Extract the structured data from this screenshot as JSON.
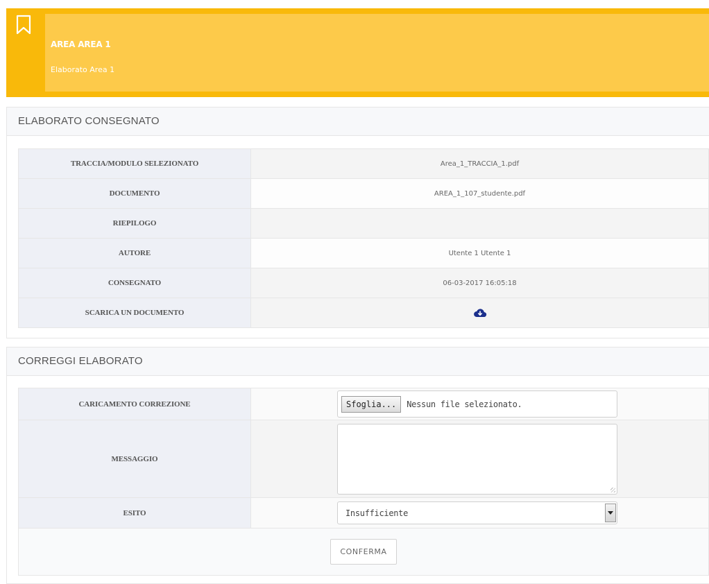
{
  "header": {
    "title": "AREA AREA 1",
    "subtitle": "Elaborato Area 1",
    "icon": "bookmark-icon",
    "colors": {
      "outer": "#f9b90a",
      "inner": "#fdca4a"
    }
  },
  "delivered": {
    "heading": "ELABORATO CONSEGNATO",
    "rows": [
      {
        "label": "TRACCIA/MODULO SELEZIONATO",
        "value": "Area_1_TRACCIA_1.pdf"
      },
      {
        "label": "DOCUMENTO",
        "value": "AREA_1_107_studente.pdf"
      },
      {
        "label": "RIEPILOGO",
        "value": ""
      },
      {
        "label": "AUTORE",
        "value": "Utente 1 Utente 1"
      },
      {
        "label": "CONSEGNATO",
        "value": "06-03-2017 16:05:18"
      },
      {
        "label": "SCARICA UN DOCUMENTO",
        "icon": "cloud-download-icon"
      }
    ]
  },
  "correction": {
    "heading": "CORREGGI ELABORATO",
    "upload": {
      "label": "CARICAMENTO CORREZIONE",
      "button": "Sfoglia...",
      "status": "Nessun file selezionato."
    },
    "message": {
      "label": "MESSAGGIO",
      "value": ""
    },
    "outcome": {
      "label": "ESITO",
      "selected": "Insufficiente"
    },
    "submit": "CONFERMA"
  }
}
